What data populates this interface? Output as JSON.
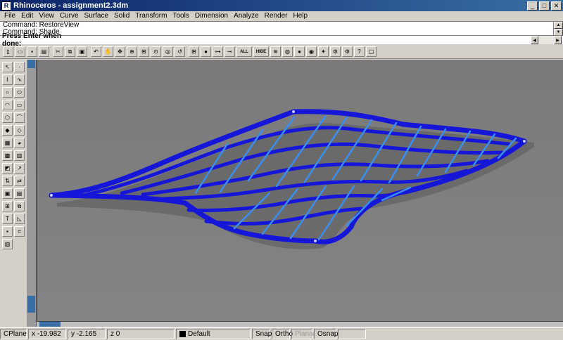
{
  "window": {
    "title": "Rhinoceros - assignment2.3dm"
  },
  "menu": [
    "File",
    "Edit",
    "View",
    "Curve",
    "Surface",
    "Solid",
    "Transform",
    "Tools",
    "Dimension",
    "Analyze",
    "Render",
    "Help"
  ],
  "command_history": [
    "Command: RestoreView",
    "Command: Shade"
  ],
  "prompt": {
    "text": "Press Enter when done:"
  },
  "toolbar": {
    "all_label": "ALL",
    "hide_label": "HIDE"
  },
  "status": {
    "cplane": "CPlane",
    "x": "x -19.982",
    "y": "y -2.165",
    "z": "z 0",
    "layer": "Default",
    "snap": "Snap",
    "ortho": "Ortho",
    "planar": "Planar",
    "osnap": "Osnap"
  },
  "colors": {
    "title_bar": "#0a246a",
    "viewport_bg": "#808080",
    "mesh_dark": "#1616d8",
    "mesh_light": "#3a8ef0"
  }
}
